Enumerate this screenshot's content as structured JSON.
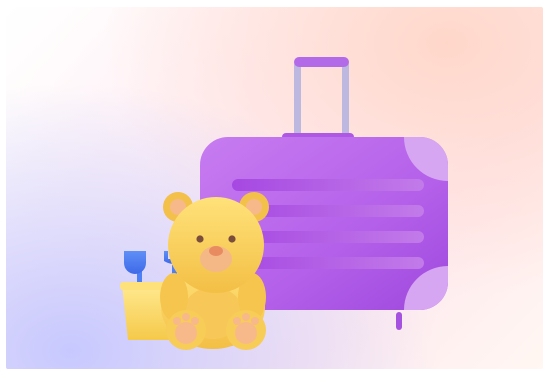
{
  "scene": {
    "subject": "teddy-bear-with-suitcase-and-sand-bucket",
    "colors": {
      "suitcase": "#b85ee6",
      "suitcase_dark": "#9a3fd6",
      "suitcase_light": "#d7a6f2",
      "handle": "#b7b4dc",
      "bear": "#f4c64a",
      "bear_light": "#ffe48a",
      "bear_muzzle": "#f2b07a",
      "bucket": "#f7d76a",
      "shovel": "#4f7ff5",
      "background_top_right": "#ffd6c8",
      "background_bottom_left": "#c4c6ff"
    }
  }
}
